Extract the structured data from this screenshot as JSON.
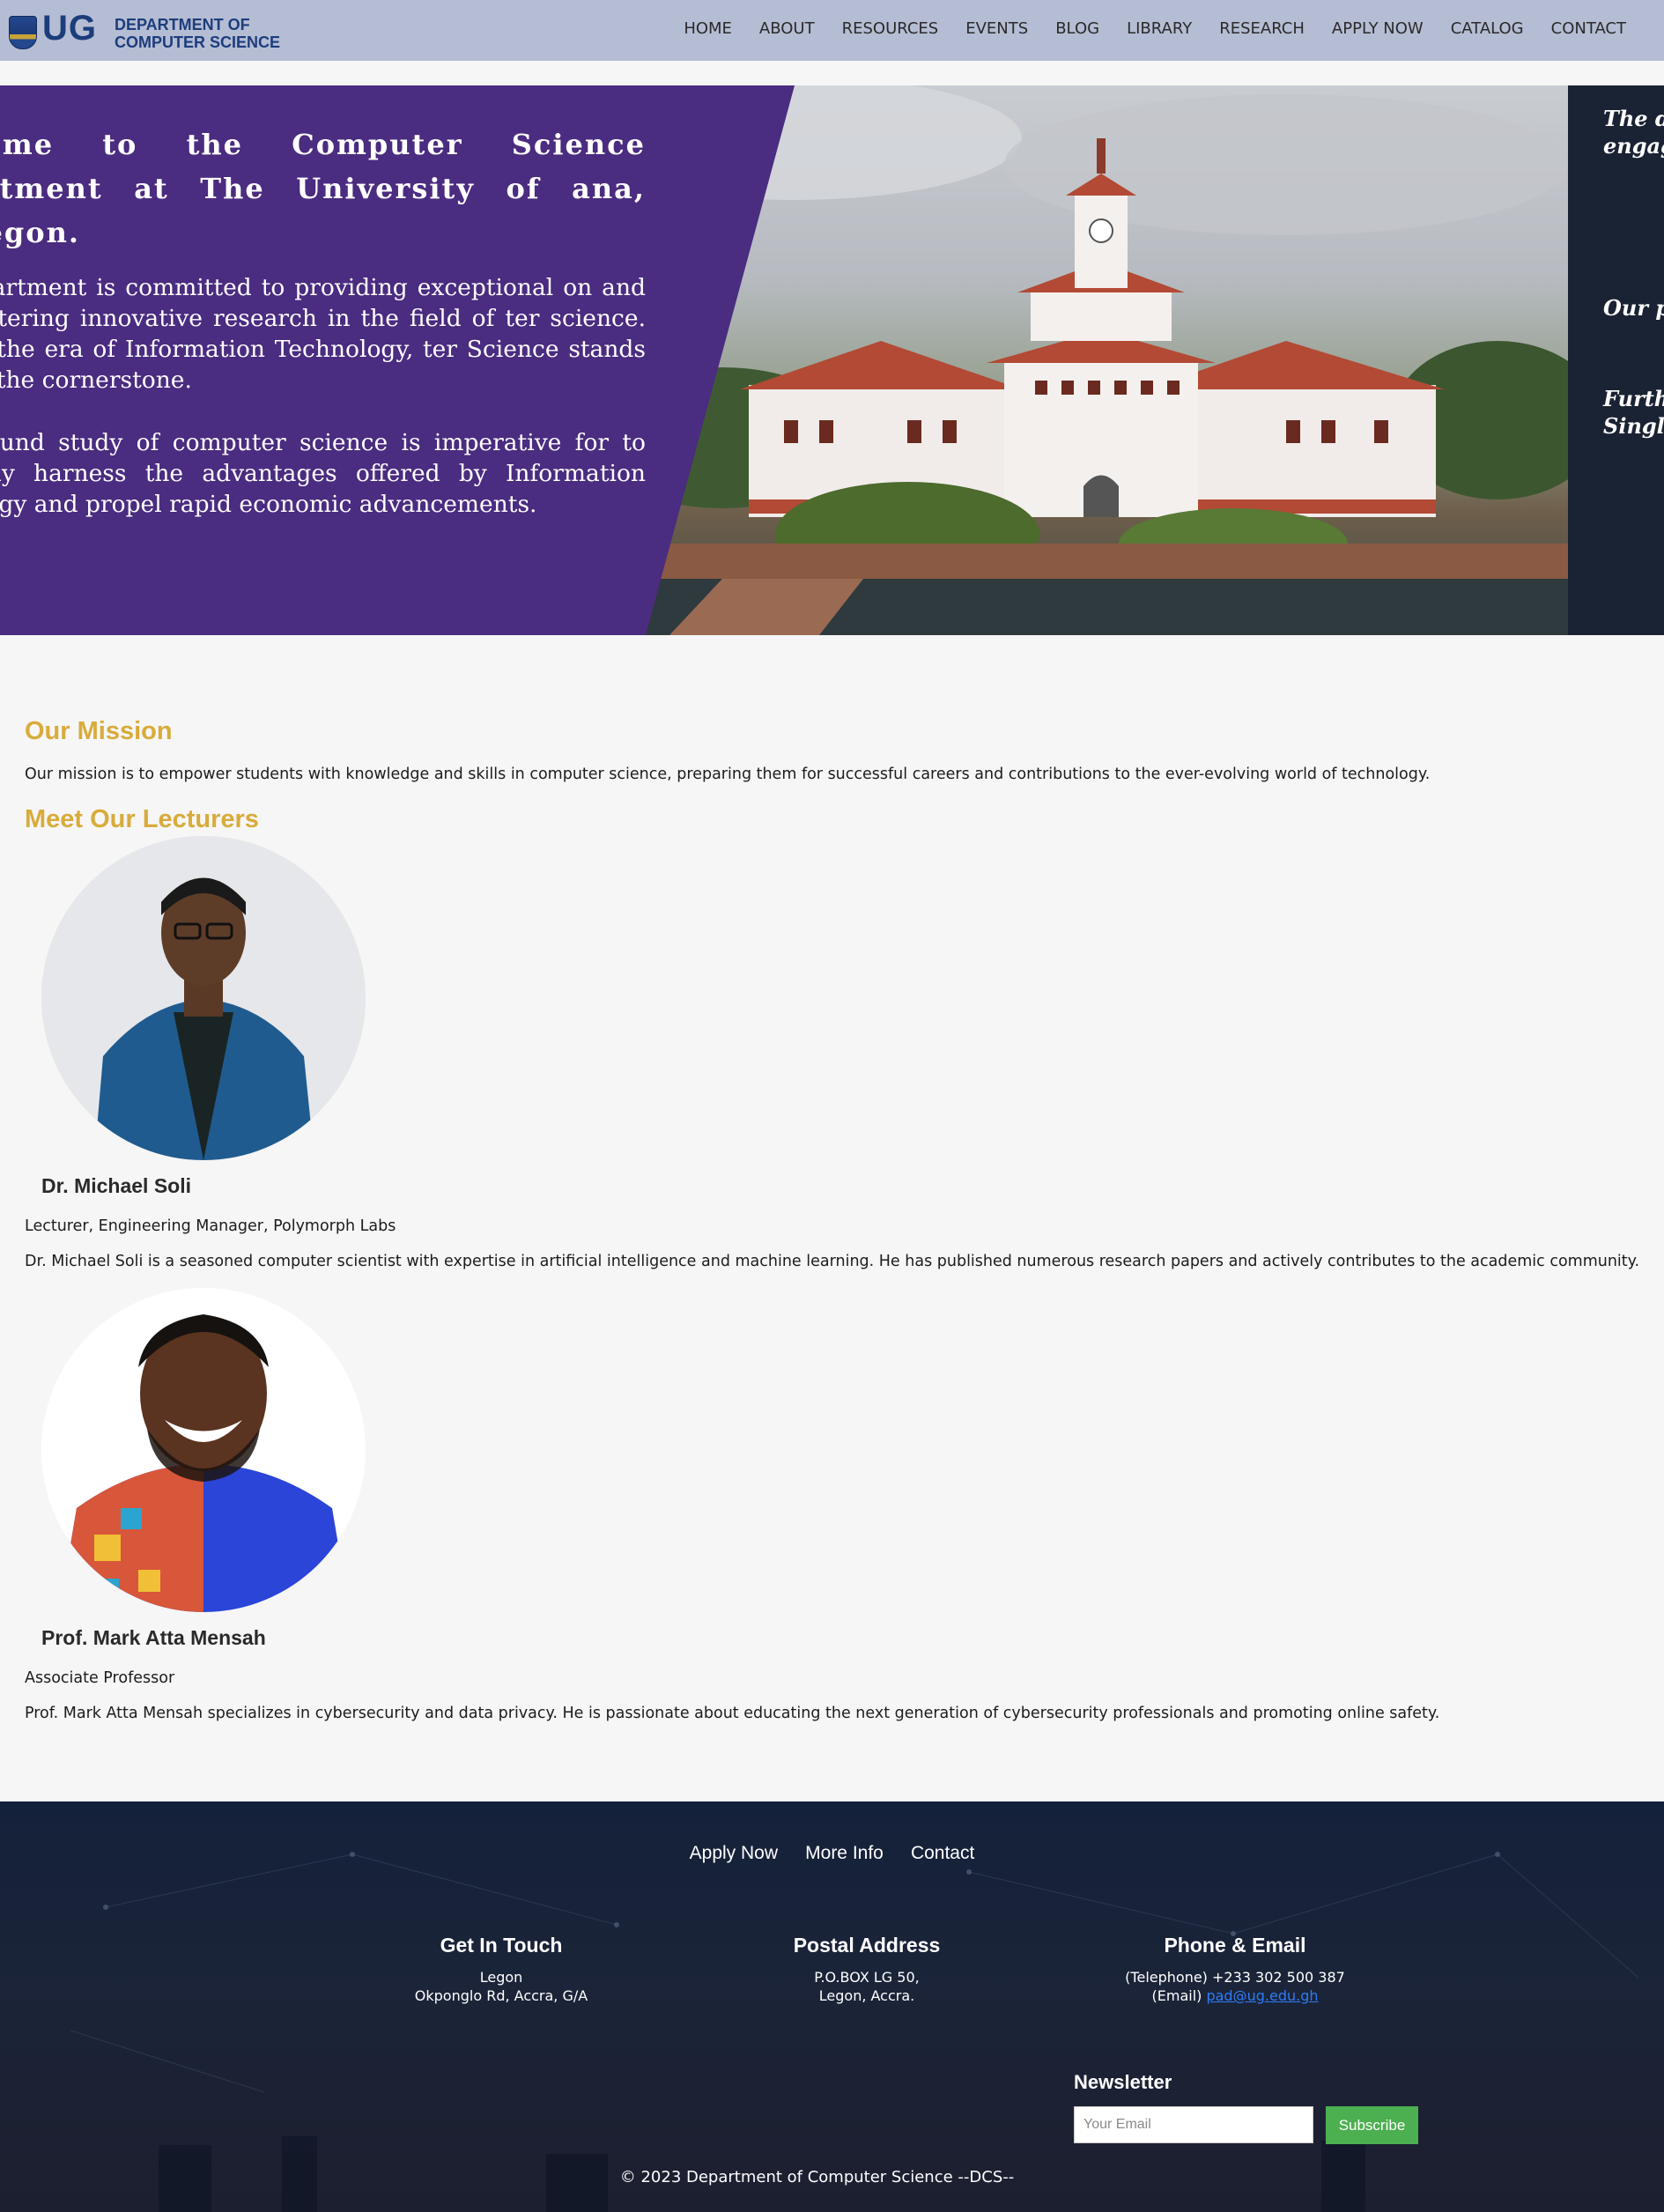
{
  "header": {
    "logo_text": "UG",
    "logo_subtitle": "DEPARTMENT OF COMPUTER SCIENCE",
    "nav": [
      "HOME",
      "ABOUT",
      "RESOURCES",
      "EVENTS",
      "BLOG",
      "LIBRARY",
      "RESEARCH",
      "APPLY NOW",
      "CATALOG",
      "CONTACT"
    ]
  },
  "hero": {
    "title": "come to the Computer Science artment at The University of ana, Legon.",
    "paragraph1": "epartment is committed to providing exceptional on and fostering innovative research in the field of ter science. In the era of Information Technology, ter Science stands as the cornerstone.",
    "paragraph2": "ofound study of computer science is imperative for to fully harness the advantages offered by Information ology and propel rapid economic advancements.",
    "side_para1": "The d acqui sector comp engag",
    "side_para2": "Our p enabl",
    "side_para3": "Furth or re techn Scien progr Singl Bache"
  },
  "mission": {
    "title": "Our Mission",
    "text": "Our mission is to empower students with knowledge and skills in computer science, preparing them for successful careers and contributions to the ever-evolving world of technology."
  },
  "lecturers": {
    "title": "Meet Our Lecturers",
    "items": [
      {
        "name": "Dr. Michael Soli",
        "role": "Lecturer, Engineering Manager, Polymorph Labs",
        "bio": "Dr. Michael Soli is a seasoned computer scientist with expertise in artificial intelligence and machine learning. He has published numerous research papers and actively contributes to the academic community."
      },
      {
        "name": "Prof. Mark Atta Mensah",
        "role": "Associate Professor",
        "bio": "Prof. Mark Atta Mensah specializes in cybersecurity and data privacy. He is passionate about educating the next generation of cybersecurity professionals and promoting online safety."
      }
    ]
  },
  "footer": {
    "links": [
      "Apply Now",
      "More Info",
      "Contact"
    ],
    "get_in_touch": {
      "title": "Get In Touch",
      "line1": "Legon",
      "line2": "Okponglo Rd, Accra, G/A"
    },
    "postal": {
      "title": "Postal Address",
      "line1": "P.O.BOX LG 50,",
      "line2": "Legon, Accra."
    },
    "phone_email": {
      "title": "Phone & Email",
      "phone": "(Telephone) +233 302 500 387",
      "email_label": "(Email)",
      "email": "pad@ug.edu.gh"
    },
    "newsletter": {
      "title": "Newsletter",
      "placeholder": "Your Email",
      "button": "Subscribe"
    },
    "copyright": "© 2023 Department of Computer Science --DCS--"
  },
  "colors": {
    "header_bg": "#b5bdd4",
    "hero_purple": "#4a2c80",
    "accent_gold": "#d8ab3b",
    "footer_bg": "#1b2438",
    "subscribe_green": "#4caf50",
    "link_blue": "#2f7cf6"
  }
}
